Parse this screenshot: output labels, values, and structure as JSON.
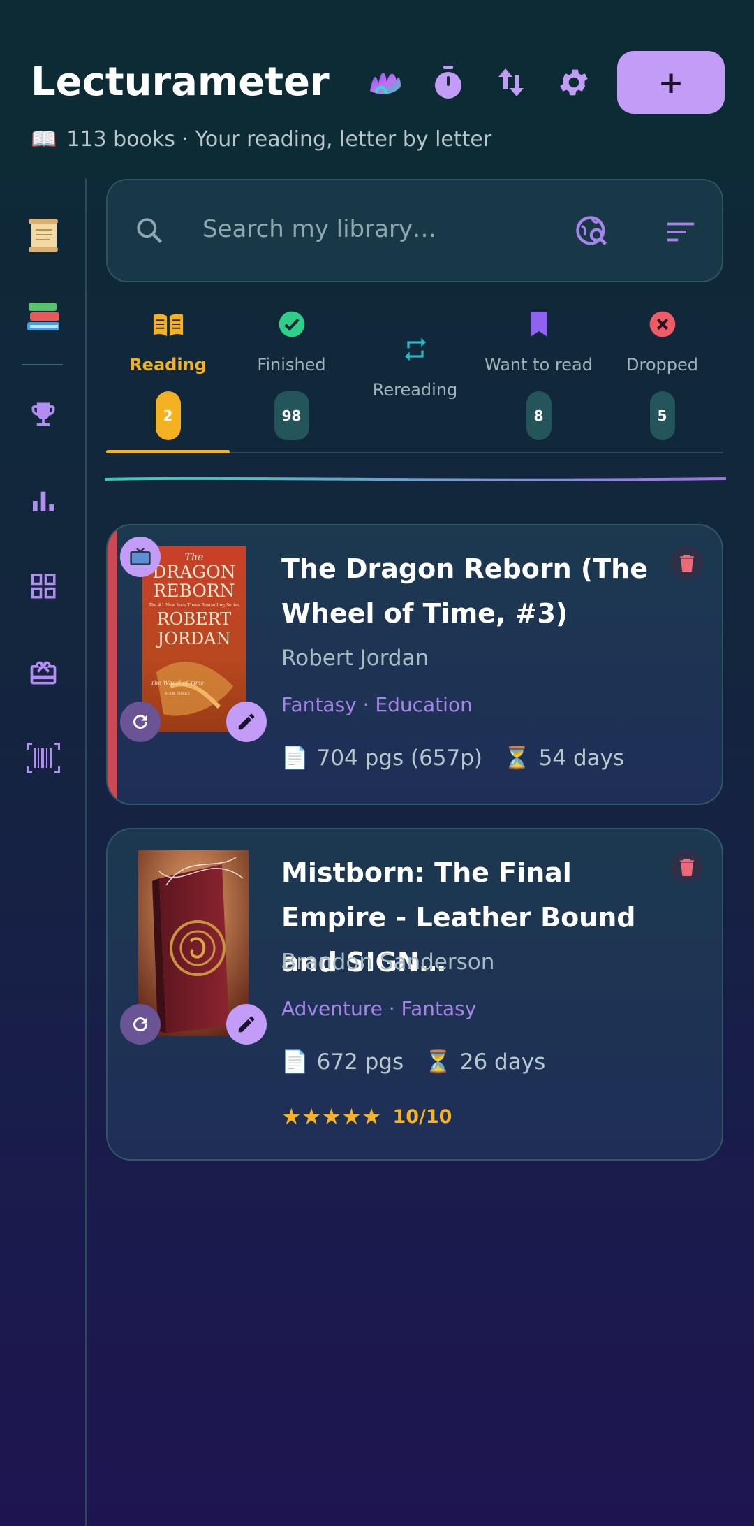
{
  "app": {
    "title": "Lecturameter",
    "subtitle_icon": "📖",
    "subtitle": "113 books · Your reading, letter by letter",
    "add_label": "+"
  },
  "header_icons": [
    "aurora-icon",
    "timer-icon",
    "sort-arrows-icon",
    "settings-icon"
  ],
  "rail": {
    "items": [
      "scroll-icon",
      "books-icon",
      "trophy-icon",
      "bar-chart-icon",
      "grid-icon",
      "gift-icon",
      "barcode-icon"
    ]
  },
  "search": {
    "placeholder": "Search my library…"
  },
  "tabs": [
    {
      "label": "Reading",
      "count": "2",
      "active": true,
      "color": "#f4b223"
    },
    {
      "label": "Finished",
      "count": "98",
      "color": "#2fcf8a"
    },
    {
      "label": "Rereading",
      "count": "",
      "color": "#29b8c9"
    },
    {
      "label": "Want to read",
      "count": "8",
      "color": "#8f62f0"
    },
    {
      "label": "Dropped",
      "count": "5",
      "color": "#ef5b66"
    }
  ],
  "books": [
    {
      "title": "The Dragon Reborn (The Wheel of Time, #3)",
      "author": "Robert Jordan",
      "genres": "Fantasy · Education",
      "pages": "704 pgs (657p)",
      "duration": "54 days",
      "cover_text": {
        "top": "The",
        "title": "DRAGON REBORN",
        "tagline": "The #1 New York Times Bestselling Series",
        "author": "ROBERT JORDAN",
        "series": "The Wheel of Time",
        "book": "BOOK THREE"
      }
    },
    {
      "title": "Mistborn: The Final Empire - Leather Bound and SIGN…",
      "author": "Brandon Sanderson",
      "genres": "Adventure · Fantasy",
      "pages": "672 pgs",
      "duration": "26 days",
      "stars": "★★★★★",
      "score": "10/10"
    }
  ],
  "colors": {
    "accent": "#c29cf7",
    "reading": "#f4b223",
    "dropped_bar": "#c94a55"
  }
}
